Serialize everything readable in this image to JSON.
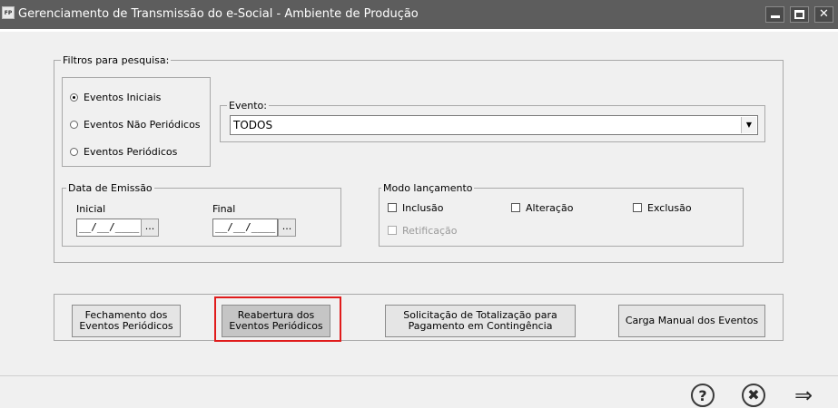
{
  "window": {
    "app_icon": "FP",
    "title": "Gerenciamento de Transmissão do e-Social - Ambiente de Produção",
    "close_glyph": "✕"
  },
  "filters": {
    "title": "Filtros para pesquisa:",
    "radio_options": [
      {
        "label": "Eventos Iniciais",
        "selected": true
      },
      {
        "label": "Eventos Não Periódicos",
        "selected": false
      },
      {
        "label": "Eventos Periódicos",
        "selected": false
      }
    ],
    "evento": {
      "label": "Evento:",
      "value": "TODOS",
      "arrow": "▼"
    }
  },
  "date_emission": {
    "title": "Data de Emissão",
    "inicial_label": "Inicial",
    "inicial_value": "__/__/____",
    "final_label": "Final",
    "final_value": "__/__/____",
    "picker_label": "..."
  },
  "modo": {
    "title": "Modo lançamento",
    "options": [
      {
        "label": "Inclusão",
        "checked": false,
        "enabled": true
      },
      {
        "label": "Alteração",
        "checked": false,
        "enabled": true
      },
      {
        "label": "Exclusão",
        "checked": false,
        "enabled": true
      },
      {
        "label": "Retificação",
        "checked": false,
        "enabled": false
      }
    ]
  },
  "actions": {
    "fechamento": "Fechamento dos Eventos Periódicos",
    "reabertura": "Reabertura dos Eventos Periódicos",
    "solicitacao": "Solicitação de Totalização para Pagamento em Contingência",
    "carga": "Carga Manual dos Eventos"
  },
  "footer": {
    "help": "?",
    "close": "✖",
    "next": "⇒"
  },
  "colors": {
    "titlebar": "#5d5d5d",
    "highlight": "#e01b1b"
  }
}
